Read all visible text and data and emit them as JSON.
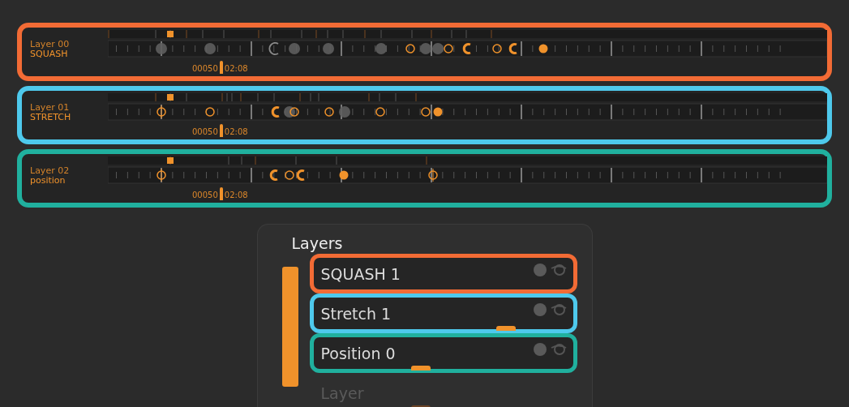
{
  "timeline": {
    "tracks": [
      {
        "layer": "Layer 00",
        "name": "SQUASH",
        "frame": "00050",
        "time": "02:08",
        "color": "#f26b35"
      },
      {
        "layer": "Layer 01",
        "name": "STRETCH",
        "frame": "00050",
        "time": "02:08",
        "color": "#4ec9ec"
      },
      {
        "layer": "Layer 02",
        "name": "position",
        "frame": "00050",
        "time": "02:08",
        "color": "#20b09e"
      }
    ]
  },
  "layers_panel": {
    "title": "Layers",
    "items": [
      {
        "name": "SQUASH 1",
        "color": "#f26b35",
        "dimmed": false
      },
      {
        "name": "Stretch 1",
        "color": "#4ec9ec",
        "dimmed": false,
        "level": 0.75
      },
      {
        "name": "Position 0",
        "color": "#20b09e",
        "dimmed": false,
        "level": 0.4
      },
      {
        "name": "Layer",
        "dimmed": true,
        "level": 0.4
      }
    ]
  }
}
